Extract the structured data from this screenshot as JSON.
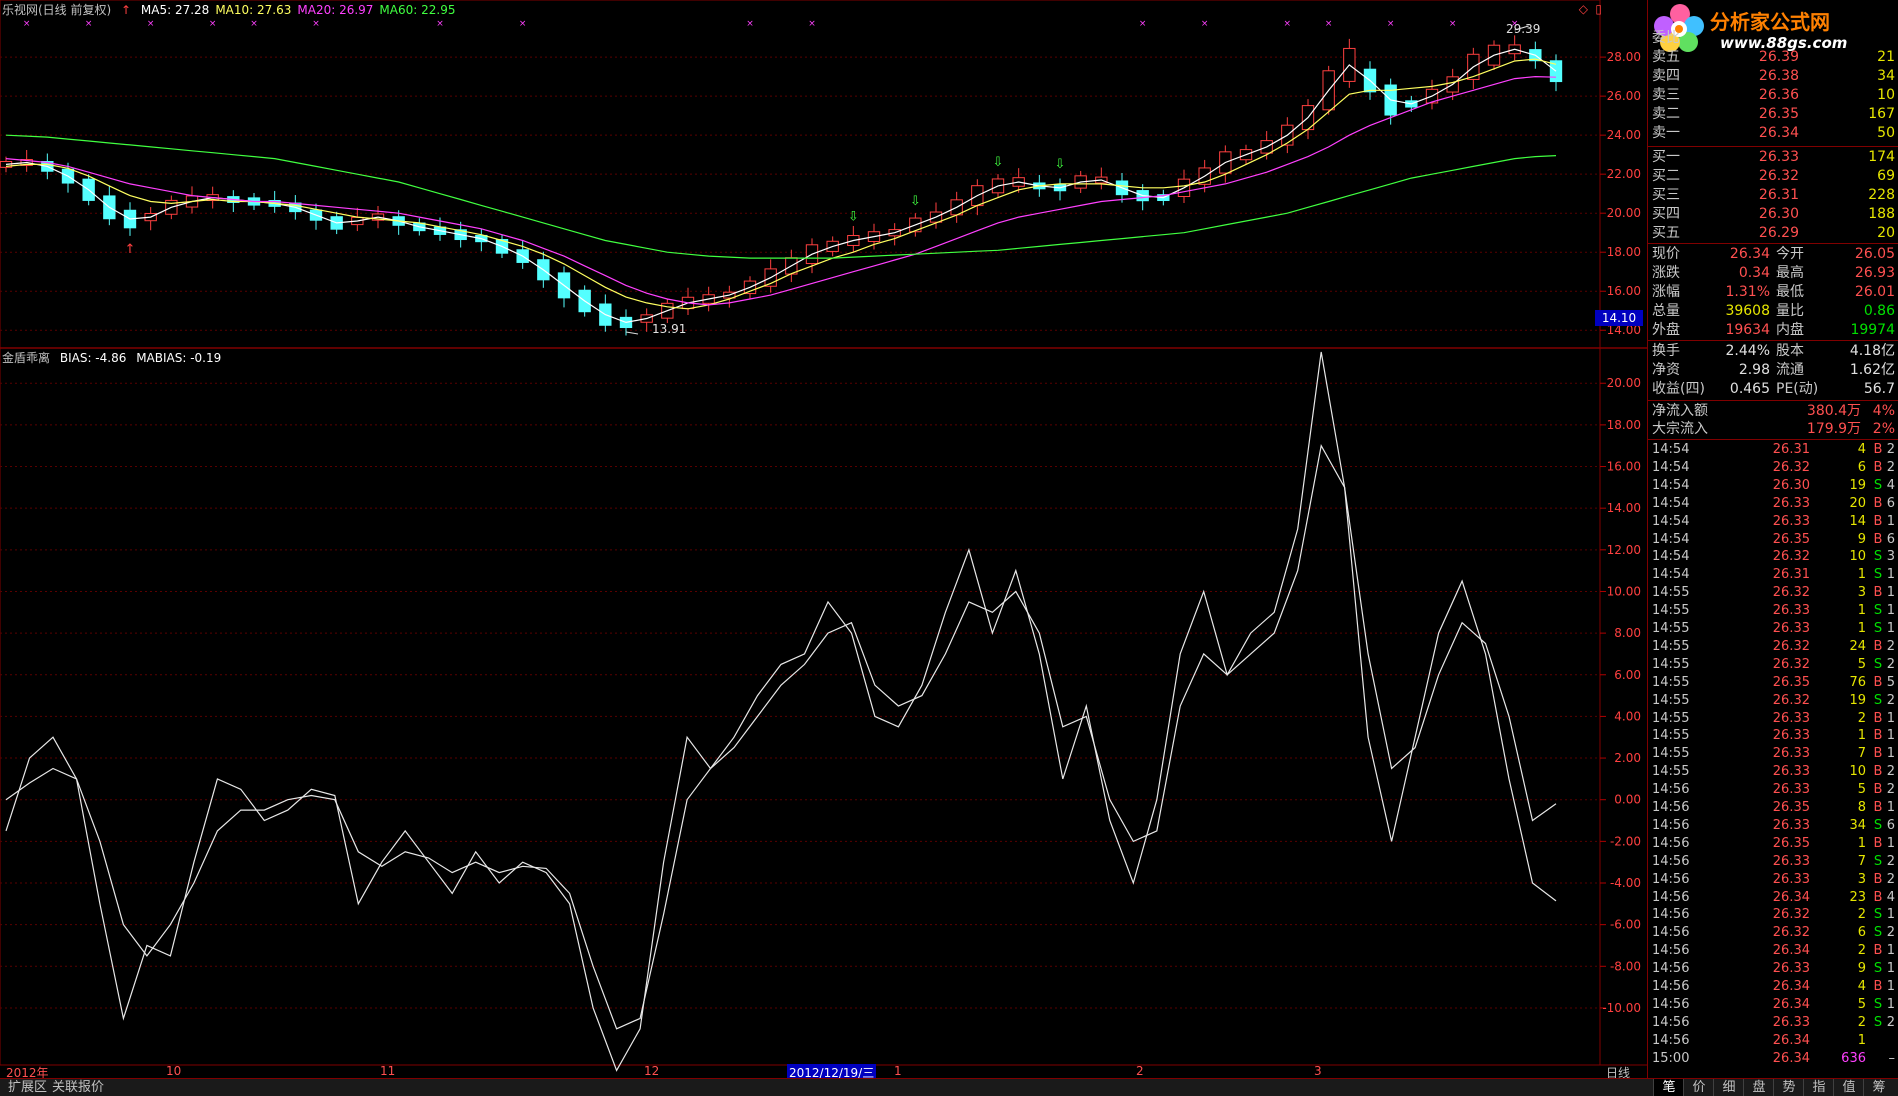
{
  "window": {
    "title": "乐视网(日线 前复权)",
    "scroll_left": "◇",
    "scroll_right": "▯"
  },
  "ma_legend": [
    {
      "text": "MA5: 27.28",
      "color": "#ffffff"
    },
    {
      "text": "MA10: 27.63",
      "color": "#ffff60"
    },
    {
      "text": "MA20: 26.97",
      "color": "#ff40ff"
    },
    {
      "text": "MA60: 22.95",
      "color": "#40ff40"
    }
  ],
  "indicator_legend": {
    "name": "金盾乖离",
    "items": [
      "BIAS: -4.86",
      "MABIAS: -0.19"
    ]
  },
  "price_axis_labels": [
    "28.00",
    "26.00",
    "24.00",
    "22.00",
    "20.00",
    "18.00",
    "16.00",
    "14.00"
  ],
  "price_axis_values": [
    28,
    26,
    24,
    22,
    20,
    18,
    16,
    14
  ],
  "current_price_tag": "14.10",
  "bias_axis_labels": [
    "20.00",
    "18.00",
    "16.00",
    "14.00",
    "12.00",
    "10.00",
    "8.00",
    "6.00",
    "4.00",
    "2.00",
    "0.00",
    "-2.00",
    "-4.00",
    "-6.00",
    "-8.00",
    "-10.00"
  ],
  "bias_axis_values": [
    20,
    18,
    16,
    14,
    12,
    10,
    8,
    6,
    4,
    2,
    0,
    -2,
    -4,
    -6,
    -8,
    -10
  ],
  "annotations": {
    "high": "29.39",
    "low": "13.91"
  },
  "time_axis": [
    {
      "label": "2012年",
      "color": "#ff5050"
    },
    {
      "label": "10",
      "color": "#ff5050"
    },
    {
      "label": "11",
      "color": "#ff5050"
    },
    {
      "label": "12",
      "color": "#ff5050"
    },
    {
      "label": "2012/12/19/三",
      "color": "#ffffff"
    },
    {
      "label": "1",
      "color": "#ff5050"
    },
    {
      "label": "2",
      "color": "#ff5050"
    },
    {
      "label": "3",
      "color": "#ff5050"
    }
  ],
  "period_label": "日线",
  "bottom_tabs": [
    "扩展区",
    "关联报价"
  ],
  "right_tabs": [
    "笔",
    "价",
    "细",
    "盘",
    "势",
    "指",
    "值",
    "筹"
  ],
  "logo": {
    "title": "分析家公式网",
    "url": "www.88gs.com"
  },
  "chart_data": [
    {
      "type": "candlestick",
      "series": [
        {
          "name": "MA5",
          "values": [
            22.5,
            22.6,
            22.4,
            21.9,
            21.2,
            20.3,
            19.7,
            19.8,
            20.3,
            20.6,
            20.8,
            20.7,
            20.6,
            20.5,
            20.3,
            19.9,
            19.5,
            19.6,
            19.8,
            19.6,
            19.3,
            19.1,
            18.9,
            18.7,
            18.3,
            17.8,
            17.1,
            16.3,
            15.5,
            14.8,
            14.4,
            14.6,
            15.0,
            15.4,
            15.6,
            15.8,
            16.2,
            16.7,
            17.3,
            17.9,
            18.3,
            18.6,
            18.8,
            19.0,
            19.4,
            19.8,
            20.3,
            20.9,
            21.4,
            21.6,
            21.4,
            21.3,
            21.6,
            21.7,
            21.3,
            20.9,
            20.8,
            21.3,
            21.9,
            22.6,
            23.0,
            23.4,
            24.0,
            24.9,
            26.3,
            27.6,
            26.8,
            25.8,
            25.6,
            26.0,
            26.6,
            27.5,
            28.1,
            28.4,
            28.1,
            27.28
          ]
        },
        {
          "name": "MA10",
          "values": [
            22.4,
            22.5,
            22.5,
            22.3,
            21.9,
            21.4,
            20.9,
            20.6,
            20.5,
            20.6,
            20.7,
            20.6,
            20.6,
            20.5,
            20.4,
            20.2,
            20.0,
            19.8,
            19.7,
            19.6,
            19.5,
            19.3,
            19.1,
            18.9,
            18.6,
            18.3,
            17.9,
            17.4,
            16.8,
            16.2,
            15.7,
            15.4,
            15.2,
            15.1,
            15.3,
            15.6,
            16.0,
            16.4,
            16.9,
            17.3,
            17.7,
            18.0,
            18.4,
            18.7,
            19.1,
            19.5,
            19.9,
            20.4,
            20.8,
            21.2,
            21.4,
            21.5,
            21.5,
            21.5,
            21.4,
            21.3,
            21.3,
            21.4,
            21.6,
            22.0,
            22.5,
            23.0,
            23.6,
            24.3,
            25.2,
            26.1,
            26.3,
            26.3,
            26.4,
            26.5,
            26.7,
            27.0,
            27.4,
            27.8,
            27.9,
            27.63
          ]
        },
        {
          "name": "MA20",
          "values": [
            22.8,
            22.7,
            22.6,
            22.4,
            22.1,
            21.8,
            21.5,
            21.3,
            21.1,
            20.9,
            20.8,
            20.7,
            20.6,
            20.6,
            20.5,
            20.4,
            20.3,
            20.2,
            20.1,
            20.0,
            19.8,
            19.6,
            19.4,
            19.2,
            18.9,
            18.6,
            18.2,
            17.8,
            17.3,
            16.8,
            16.3,
            15.9,
            15.6,
            15.4,
            15.3,
            15.4,
            15.6,
            15.8,
            16.1,
            16.4,
            16.7,
            17.0,
            17.3,
            17.6,
            17.9,
            18.3,
            18.7,
            19.1,
            19.5,
            19.8,
            20.0,
            20.2,
            20.4,
            20.6,
            20.7,
            20.8,
            20.9,
            21.1,
            21.3,
            21.5,
            21.8,
            22.1,
            22.5,
            22.9,
            23.4,
            24.0,
            24.5,
            24.9,
            25.3,
            25.7,
            26.0,
            26.3,
            26.6,
            26.9,
            27.0,
            26.97
          ]
        },
        {
          "name": "MA60",
          "values": [
            24.0,
            23.95,
            23.9,
            23.8,
            23.7,
            23.6,
            23.5,
            23.4,
            23.3,
            23.2,
            23.1,
            23.0,
            22.9,
            22.8,
            22.6,
            22.4,
            22.2,
            22.0,
            21.8,
            21.6,
            21.3,
            21.0,
            20.7,
            20.4,
            20.1,
            19.8,
            19.5,
            19.2,
            18.9,
            18.6,
            18.4,
            18.2,
            18.0,
            17.9,
            17.8,
            17.75,
            17.7,
            17.7,
            17.7,
            17.7,
            17.7,
            17.75,
            17.8,
            17.85,
            17.9,
            17.95,
            18.0,
            18.05,
            18.1,
            18.2,
            18.3,
            18.4,
            18.5,
            18.6,
            18.7,
            18.8,
            18.9,
            19.0,
            19.2,
            19.4,
            19.6,
            19.8,
            20.0,
            20.3,
            20.6,
            20.9,
            21.2,
            21.5,
            21.8,
            22.0,
            22.2,
            22.4,
            22.6,
            22.8,
            22.9,
            22.95
          ]
        }
      ],
      "price_range": [
        13.5,
        29.8
      ],
      "high": 29.39,
      "low": 13.91
    },
    {
      "type": "line",
      "title": "金盾乖离",
      "series": [
        {
          "name": "BIAS",
          "values": [
            -1.5,
            2.0,
            3.0,
            1.0,
            -5.0,
            -10.5,
            -7.0,
            -7.5,
            -3.0,
            1.0,
            0.5,
            -1.0,
            -0.5,
            0.5,
            0.2,
            -5.0,
            -3.0,
            -1.5,
            -3.0,
            -4.5,
            -2.5,
            -4.0,
            -3.0,
            -3.5,
            -5.0,
            -10.0,
            -13.0,
            -11.0,
            -3.0,
            3.0,
            1.5,
            3.0,
            5.0,
            6.5,
            7.0,
            9.5,
            8.0,
            4.0,
            3.5,
            5.5,
            9.0,
            12.0,
            8.0,
            11.0,
            7.0,
            1.0,
            4.5,
            -1.0,
            -4.0,
            0.0,
            7.0,
            10.0,
            6.0,
            8.0,
            9.0,
            13.0,
            21.5,
            15.0,
            3.0,
            -2.0,
            3.0,
            8.0,
            10.5,
            7.0,
            1.0,
            -4.0,
            -4.86
          ]
        },
        {
          "name": "MABIAS",
          "values": [
            0.0,
            0.8,
            1.5,
            1.0,
            -2.0,
            -6.0,
            -7.5,
            -6.0,
            -4.0,
            -1.5,
            -0.5,
            -0.5,
            0.0,
            0.2,
            0.0,
            -2.5,
            -3.2,
            -2.5,
            -2.8,
            -3.5,
            -3.0,
            -3.5,
            -3.2,
            -3.3,
            -4.5,
            -8.0,
            -11.0,
            -10.5,
            -5.5,
            0.0,
            1.5,
            2.5,
            4.0,
            5.5,
            6.5,
            8.0,
            8.5,
            5.5,
            4.5,
            5.0,
            7.0,
            9.5,
            9.0,
            10.0,
            8.0,
            3.5,
            4.0,
            0.0,
            -2.0,
            -1.5,
            4.5,
            7.0,
            6.0,
            7.0,
            8.0,
            11.0,
            17.0,
            15.0,
            7.0,
            1.5,
            2.5,
            6.0,
            8.5,
            7.5,
            4.0,
            -1.0,
            -0.19
          ]
        }
      ],
      "ylim": [
        -12.5,
        21.5
      ]
    }
  ],
  "panel": {
    "weibi": {
      "label": "委比"
    },
    "asks": [
      {
        "label": "卖五",
        "price": "26.39",
        "vol": "21"
      },
      {
        "label": "卖四",
        "price": "26.38",
        "vol": "34"
      },
      {
        "label": "卖三",
        "price": "26.36",
        "vol": "10"
      },
      {
        "label": "卖二",
        "price": "26.35",
        "vol": "167"
      },
      {
        "label": "卖一",
        "price": "26.34",
        "vol": "50"
      }
    ],
    "bids": [
      {
        "label": "买一",
        "price": "26.33",
        "vol": "174"
      },
      {
        "label": "买二",
        "price": "26.32",
        "vol": "69"
      },
      {
        "label": "买三",
        "price": "26.31",
        "vol": "228"
      },
      {
        "label": "买四",
        "price": "26.30",
        "vol": "188"
      },
      {
        "label": "买五",
        "price": "26.29",
        "vol": "20"
      }
    ],
    "quote": [
      {
        "l1": "现价",
        "v1": "26.34",
        "c1": "red",
        "l2": "今开",
        "v2": "26.05",
        "c2": "red"
      },
      {
        "l1": "涨跌",
        "v1": "0.34",
        "c1": "red",
        "l2": "最高",
        "v2": "26.93",
        "c2": "red"
      },
      {
        "l1": "涨幅",
        "v1": "1.31%",
        "c1": "red",
        "l2": "最低",
        "v2": "26.01",
        "c2": "red"
      },
      {
        "l1": "总量",
        "v1": "39608",
        "c1": "yel",
        "l2": "量比",
        "v2": "0.86",
        "c2": "green"
      },
      {
        "l1": "外盘",
        "v1": "19634",
        "c1": "red",
        "l2": "内盘",
        "v2": "19974",
        "c2": "green"
      }
    ],
    "fund": [
      {
        "l1": "换手",
        "v1": "2.44%",
        "c1": "wht",
        "l2": "股本",
        "v2": "4.18亿",
        "c2": "wht"
      },
      {
        "l1": "净资",
        "v1": "2.98",
        "c1": "wht",
        "l2": "流通",
        "v2": "1.62亿",
        "c2": "wht"
      },
      {
        "l1": "收益(四)",
        "v1": "0.465",
        "c1": "wht",
        "l2": "PE(动)",
        "v2": "56.7",
        "c2": "wht"
      }
    ],
    "flows": [
      {
        "label": "净流入额",
        "value": "380.4万",
        "pct": "4%"
      },
      {
        "label": "大宗流入",
        "value": "179.9万",
        "pct": "2%"
      }
    ],
    "trades": [
      {
        "t": "14:54",
        "p": "26.31",
        "v": "4",
        "d": "B",
        "n": "2"
      },
      {
        "t": "14:54",
        "p": "26.32",
        "v": "6",
        "d": "B",
        "n": "2"
      },
      {
        "t": "14:54",
        "p": "26.30",
        "v": "19",
        "d": "S",
        "n": "4"
      },
      {
        "t": "14:54",
        "p": "26.33",
        "v": "20",
        "d": "B",
        "n": "6"
      },
      {
        "t": "14:54",
        "p": "26.33",
        "v": "14",
        "d": "B",
        "n": "1"
      },
      {
        "t": "14:54",
        "p": "26.35",
        "v": "9",
        "d": "B",
        "n": "6"
      },
      {
        "t": "14:54",
        "p": "26.32",
        "v": "10",
        "d": "S",
        "n": "3"
      },
      {
        "t": "14:54",
        "p": "26.31",
        "v": "1",
        "d": "S",
        "n": "1"
      },
      {
        "t": "14:55",
        "p": "26.32",
        "v": "3",
        "d": "B",
        "n": "1"
      },
      {
        "t": "14:55",
        "p": "26.33",
        "v": "1",
        "d": "S",
        "n": "1"
      },
      {
        "t": "14:55",
        "p": "26.33",
        "v": "1",
        "d": "S",
        "n": "1"
      },
      {
        "t": "14:55",
        "p": "26.32",
        "v": "24",
        "d": "B",
        "n": "2"
      },
      {
        "t": "14:55",
        "p": "26.32",
        "v": "5",
        "d": "S",
        "n": "2"
      },
      {
        "t": "14:55",
        "p": "26.35",
        "v": "76",
        "d": "B",
        "n": "5"
      },
      {
        "t": "14:55",
        "p": "26.32",
        "v": "19",
        "d": "S",
        "n": "2"
      },
      {
        "t": "14:55",
        "p": "26.33",
        "v": "2",
        "d": "B",
        "n": "1"
      },
      {
        "t": "14:55",
        "p": "26.33",
        "v": "1",
        "d": "B",
        "n": "1"
      },
      {
        "t": "14:55",
        "p": "26.33",
        "v": "7",
        "d": "B",
        "n": "1"
      },
      {
        "t": "14:55",
        "p": "26.33",
        "v": "10",
        "d": "B",
        "n": "2"
      },
      {
        "t": "14:56",
        "p": "26.33",
        "v": "5",
        "d": "B",
        "n": "2"
      },
      {
        "t": "14:56",
        "p": "26.35",
        "v": "8",
        "d": "B",
        "n": "1"
      },
      {
        "t": "14:56",
        "p": "26.33",
        "v": "34",
        "d": "S",
        "n": "6"
      },
      {
        "t": "14:56",
        "p": "26.35",
        "v": "1",
        "d": "B",
        "n": "1"
      },
      {
        "t": "14:56",
        "p": "26.33",
        "v": "7",
        "d": "S",
        "n": "2"
      },
      {
        "t": "14:56",
        "p": "26.33",
        "v": "3",
        "d": "B",
        "n": "2"
      },
      {
        "t": "14:56",
        "p": "26.34",
        "v": "23",
        "d": "B",
        "n": "4"
      },
      {
        "t": "14:56",
        "p": "26.32",
        "v": "2",
        "d": "S",
        "n": "1"
      },
      {
        "t": "14:56",
        "p": "26.32",
        "v": "6",
        "d": "S",
        "n": "2"
      },
      {
        "t": "14:56",
        "p": "26.34",
        "v": "2",
        "d": "B",
        "n": "1"
      },
      {
        "t": "14:56",
        "p": "26.33",
        "v": "9",
        "d": "S",
        "n": "1"
      },
      {
        "t": "14:56",
        "p": "26.34",
        "v": "4",
        "d": "B",
        "n": "1"
      },
      {
        "t": "14:56",
        "p": "26.34",
        "v": "5",
        "d": "S",
        "n": "1"
      },
      {
        "t": "14:56",
        "p": "26.33",
        "v": "2",
        "d": "S",
        "n": "2"
      },
      {
        "t": "14:56",
        "p": "26.34",
        "v": "1",
        "d": "",
        "n": ""
      },
      {
        "t": "15:00",
        "p": "26.34",
        "v": "636",
        "d": "",
        "n": "–"
      }
    ]
  }
}
